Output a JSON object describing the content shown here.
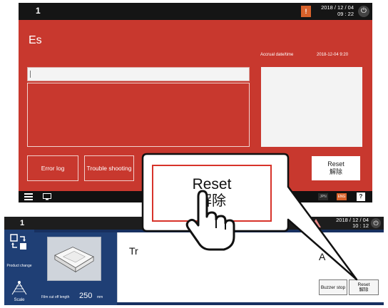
{
  "top_screen": {
    "status": {
      "screen_number": "1",
      "alert_badge": "!",
      "date": "2018 / 12 / 04",
      "time": "09 : 22",
      "power_icon": "power-icon"
    },
    "panel_color": "#c8382e",
    "title": "Es",
    "accrual_label": "Accrual date/time",
    "accrual_value": "2018-12-04  9:20",
    "buttons": {
      "error_log": "Error log",
      "trouble_shooting": "Trouble shooting",
      "reset_en": "Reset",
      "reset_jp": "解除"
    },
    "bottom_bar": {
      "menu_icon": "menu-icon",
      "monitor_icon": "monitor-icon",
      "lang_jpn": "JPN",
      "lang_eng": "ENG",
      "help": "?"
    }
  },
  "bottom_screen": {
    "status": {
      "screen_number": "1",
      "warning_icon": "warning-triangle-icon",
      "date": "2018 / 12 / 04",
      "time": "10 : 12",
      "power_icon": "power-icon"
    },
    "sidebar": {
      "product_change_label": "Product change",
      "scale_label": "Scale"
    },
    "product": {
      "film_cut_off_label": "Film cut off length",
      "film_cut_off_value": "250",
      "film_cut_off_unit": "mm"
    },
    "main": {
      "title_partial": "Tr",
      "right_partial": "A",
      "buzzer_stop": "Buzzer stop",
      "reset_en": "Reset",
      "reset_jp": "解除"
    }
  },
  "callout": {
    "reset_en": "Reset",
    "reset_jp": "解除",
    "hand_icon": "pointing-hand-icon",
    "accent_color": "#d7332a"
  }
}
